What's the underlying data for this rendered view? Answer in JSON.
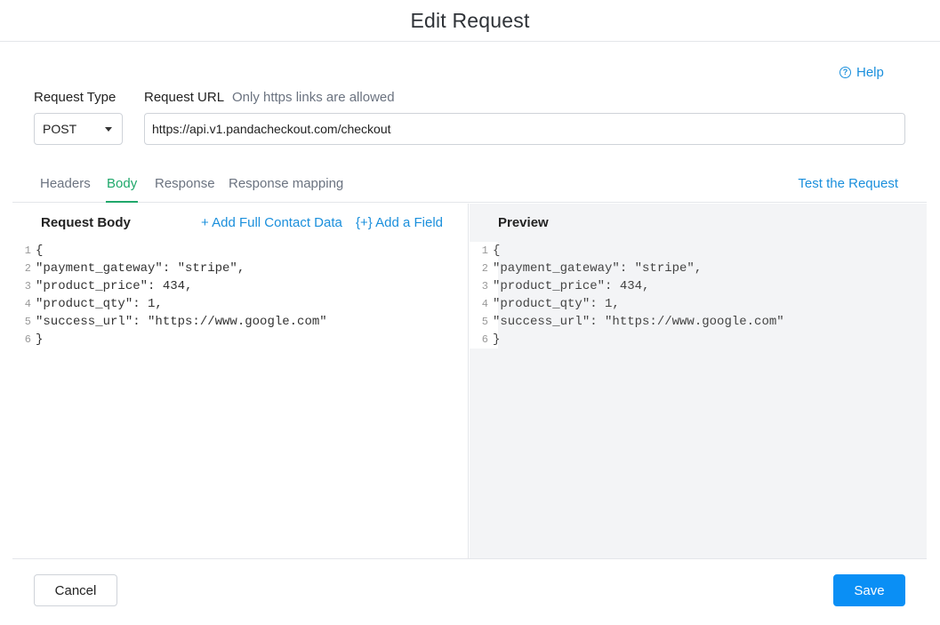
{
  "header": {
    "title": "Edit Request"
  },
  "help": {
    "label": "Help",
    "icon": "help-circle-icon",
    "icon_glyph": "?"
  },
  "request_type": {
    "label": "Request Type",
    "value": "POST"
  },
  "request_url": {
    "label": "Request URL",
    "hint": "Only https links are allowed",
    "value": "https://api.v1.pandacheckout.com/checkout"
  },
  "tabs": [
    {
      "label": "Headers"
    },
    {
      "label": "Body",
      "active": true
    },
    {
      "label": "Response"
    },
    {
      "label": "Response mapping"
    }
  ],
  "test_request": {
    "label": "Test the Request"
  },
  "request_body": {
    "title": "Request Body",
    "add_contact_label": "+ Add Full Contact Data",
    "add_field_label": "{+} Add a Field",
    "lines": [
      {
        "n": "1",
        "text": "{"
      },
      {
        "n": "2",
        "text": "\"payment_gateway\": \"stripe\","
      },
      {
        "n": "3",
        "text": "\"product_price\": 434,"
      },
      {
        "n": "4",
        "text": "\"product_qty\": 1,"
      },
      {
        "n": "5",
        "text": "\"success_url\": \"https://www.google.com\""
      },
      {
        "n": "6",
        "text": "}"
      }
    ]
  },
  "preview": {
    "title": "Preview",
    "lines": [
      {
        "n": "1",
        "text": "{"
      },
      {
        "n": "2",
        "text": "\"payment_gateway\": \"stripe\","
      },
      {
        "n": "3",
        "text": "\"product_price\": 434,"
      },
      {
        "n": "4",
        "text": "\"product_qty\": 1,"
      },
      {
        "n": "5",
        "text": "\"success_url\": \"https://www.google.com\""
      },
      {
        "n": "6",
        "text": "}"
      }
    ]
  },
  "footer": {
    "cancel_label": "Cancel",
    "save_label": "Save"
  },
  "colors": {
    "accent_blue": "#1a8fdc",
    "active_tab": "#20a86b",
    "save_button": "#0a8ff5"
  }
}
